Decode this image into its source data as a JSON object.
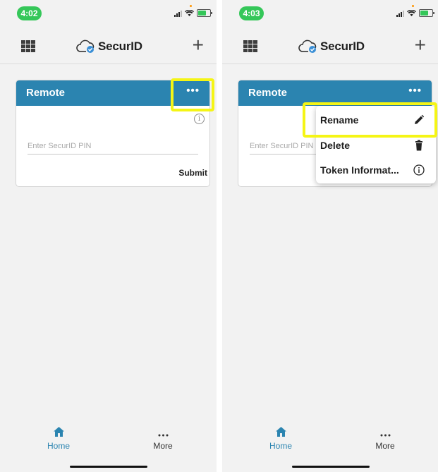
{
  "screens": {
    "left": {
      "status_time": "4:02",
      "app_name": "SecurID",
      "card": {
        "title": "Remote",
        "more_icon": "•••",
        "info_icon": "i",
        "pin_placeholder": "Enter SecurID PIN",
        "submit_label": "Submit"
      },
      "tabs": {
        "home_label": "Home",
        "more_label": "More"
      }
    },
    "right": {
      "status_time": "4:03",
      "app_name": "SecurID",
      "card": {
        "title": "Remote",
        "more_icon": "•••",
        "pin_placeholder": "Enter SecurID PIN"
      },
      "menu": [
        {
          "label": "Rename",
          "icon": "pencil-icon"
        },
        {
          "label": "Delete",
          "icon": "trash-icon"
        },
        {
          "label": "Token Informat...",
          "icon": "info-icon"
        }
      ],
      "tabs": {
        "home_label": "Home",
        "more_label": "More"
      }
    }
  },
  "colors": {
    "accent": "#2b84b0",
    "status_pill": "#35c759",
    "highlight": "#f5f515"
  }
}
